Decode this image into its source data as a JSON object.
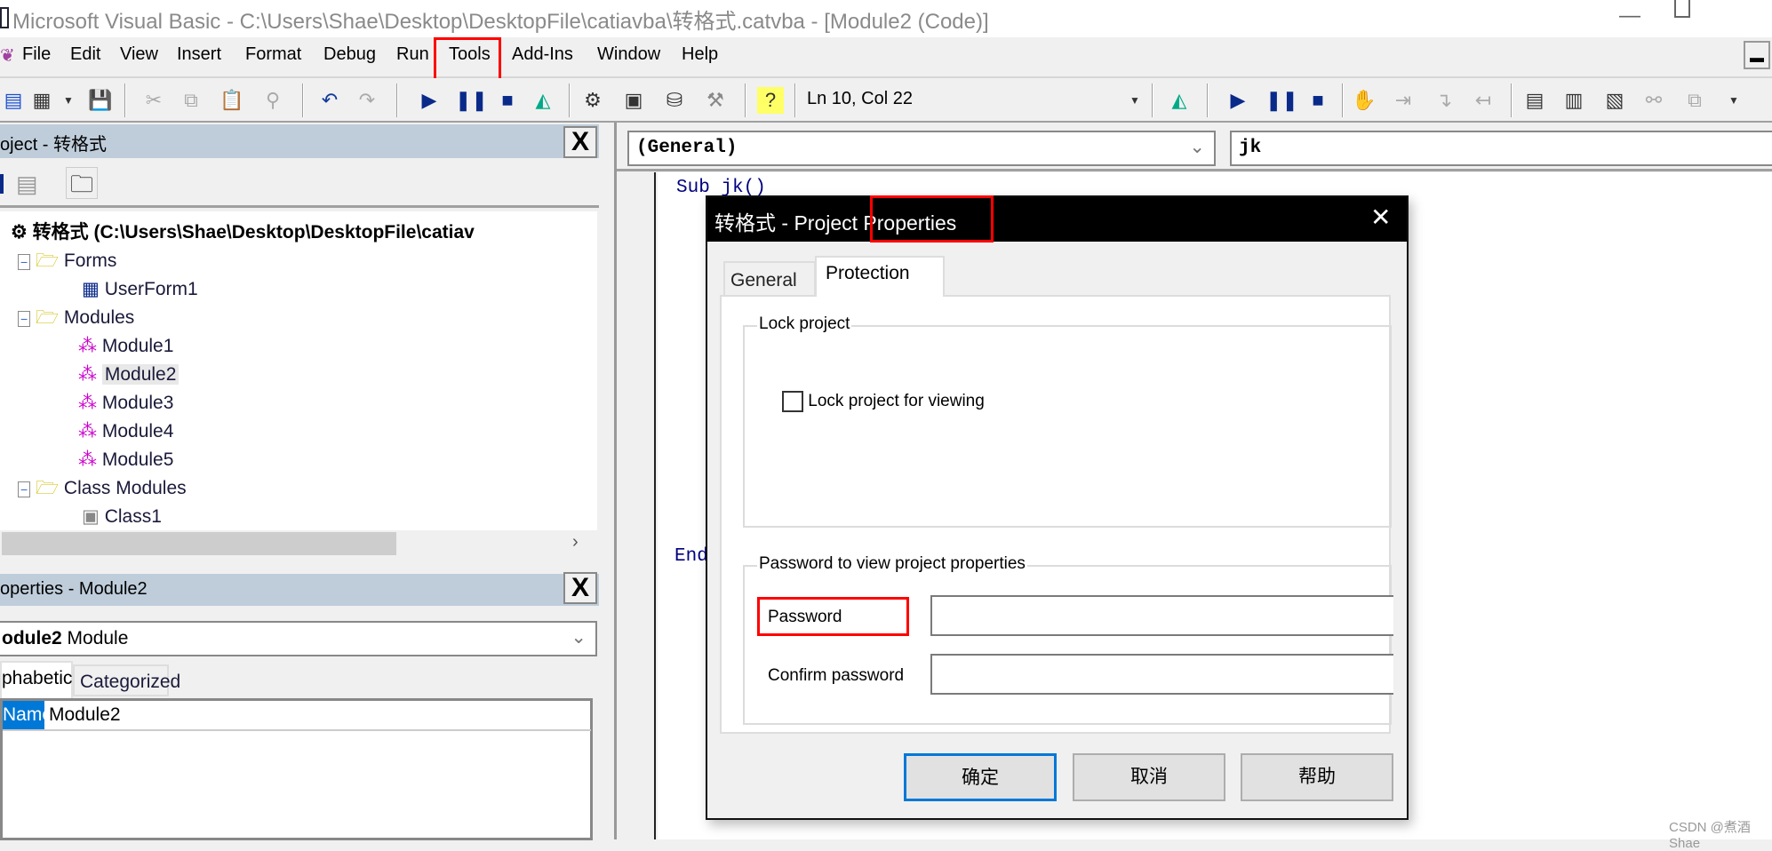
{
  "window": {
    "title": "Microsoft Visual Basic - C:\\Users\\Shae\\Desktop\\DesktopFile\\catiavba\\转格式.catvba - [Module2 (Code)]"
  },
  "menu": [
    "File",
    "Edit",
    "View",
    "Insert",
    "Format",
    "Debug",
    "Run",
    "Tools",
    "Add-Ins",
    "Window",
    "Help"
  ],
  "toolbar": {
    "position": "Ln 10, Col 22"
  },
  "project_panel": {
    "title": "oject - 转格式",
    "root": "转格式 (C:\\Users\\Shae\\Desktop\\DesktopFile\\catiav",
    "nodes": [
      {
        "label": "Forms",
        "type": "folder"
      },
      {
        "label": "UserForm1",
        "type": "form"
      },
      {
        "label": "Modules",
        "type": "folder"
      },
      {
        "label": "Module1",
        "type": "module"
      },
      {
        "label": "Module2",
        "type": "module",
        "selected": true
      },
      {
        "label": "Module3",
        "type": "module"
      },
      {
        "label": "Module4",
        "type": "module"
      },
      {
        "label": "Module5",
        "type": "module"
      },
      {
        "label": "Class Modules",
        "type": "folder"
      },
      {
        "label": "Class1",
        "type": "class"
      }
    ]
  },
  "properties_panel": {
    "title": "operties - Module2",
    "object_name": "odule2",
    "object_type": "Module",
    "tabs": [
      "phabetic",
      "Categorized"
    ],
    "rows": [
      {
        "name": "Name)",
        "value": "Module2"
      }
    ]
  },
  "code": {
    "object_combo": "(General)",
    "proc_combo": "jk",
    "lines": [
      "Sub jk()",
      "End"
    ]
  },
  "dialog": {
    "title": "转格式 - Project Properties",
    "tabs": [
      "General",
      "Protection"
    ],
    "active_tab": "Protection",
    "lock_group": "Lock project",
    "lock_checkbox": "Lock project for viewing",
    "lock_checked": false,
    "password_group": "Password to view project properties",
    "password_label": "Password",
    "confirm_label": "Confirm password",
    "password_value": "",
    "confirm_value": "",
    "ok": "确定",
    "cancel": "取消",
    "help": "帮助"
  },
  "watermark": "CSDN @煮酒Shae",
  "colors": {
    "highlight": "#ff0000",
    "panel_title": "#bfcddb",
    "selection": "#0078d7"
  }
}
